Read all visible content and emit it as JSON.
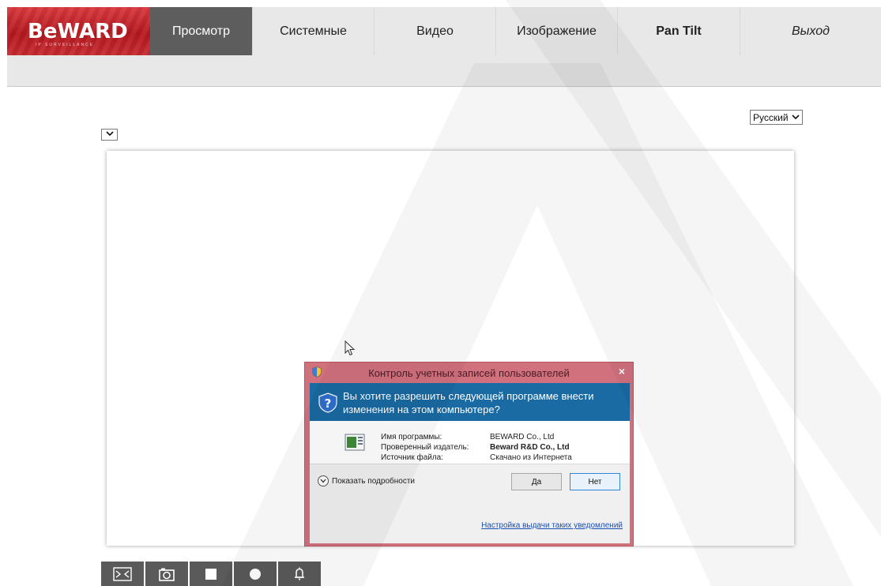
{
  "logo": {
    "main": "BeWARD",
    "sub": "IP SURVEILLANCE"
  },
  "nav": {
    "items": [
      {
        "label": "Просмотр",
        "active": true
      },
      {
        "label": "Системные"
      },
      {
        "label": "Видео"
      },
      {
        "label": "Изображение"
      },
      {
        "label": "Pan Tilt",
        "bold": true
      },
      {
        "label": "Выход",
        "italic": true
      }
    ]
  },
  "language": {
    "selected": "Русский"
  },
  "uac": {
    "title": "Контроль учетных записей пользователей",
    "question": "Вы хотите разрешить следующей программе внести изменения на этом компьютере?",
    "labels": [
      "Имя программы:",
      "Проверенный издатель:",
      "Источник файла:"
    ],
    "values": [
      "BEWARD Co., Ltd",
      "Beward R&D Co., Ltd",
      "Скачано из Интернета"
    ],
    "show_details": "Показать подробности",
    "yes": "Да",
    "no": "Нет",
    "settings_link": "Настройка выдачи таких уведомлений",
    "close": "×"
  },
  "controls": {
    "items": [
      "fullscreen-icon",
      "camera-snapshot-icon",
      "stop-icon",
      "record-icon",
      "alarm-bell-icon"
    ]
  },
  "colors": {
    "brand_red": "#c52a30",
    "nav_active": "#5d5d5d",
    "uac_frame": "#d1717e",
    "uac_header": "#1a6aa3",
    "control_bg": "#5a5a5a"
  }
}
